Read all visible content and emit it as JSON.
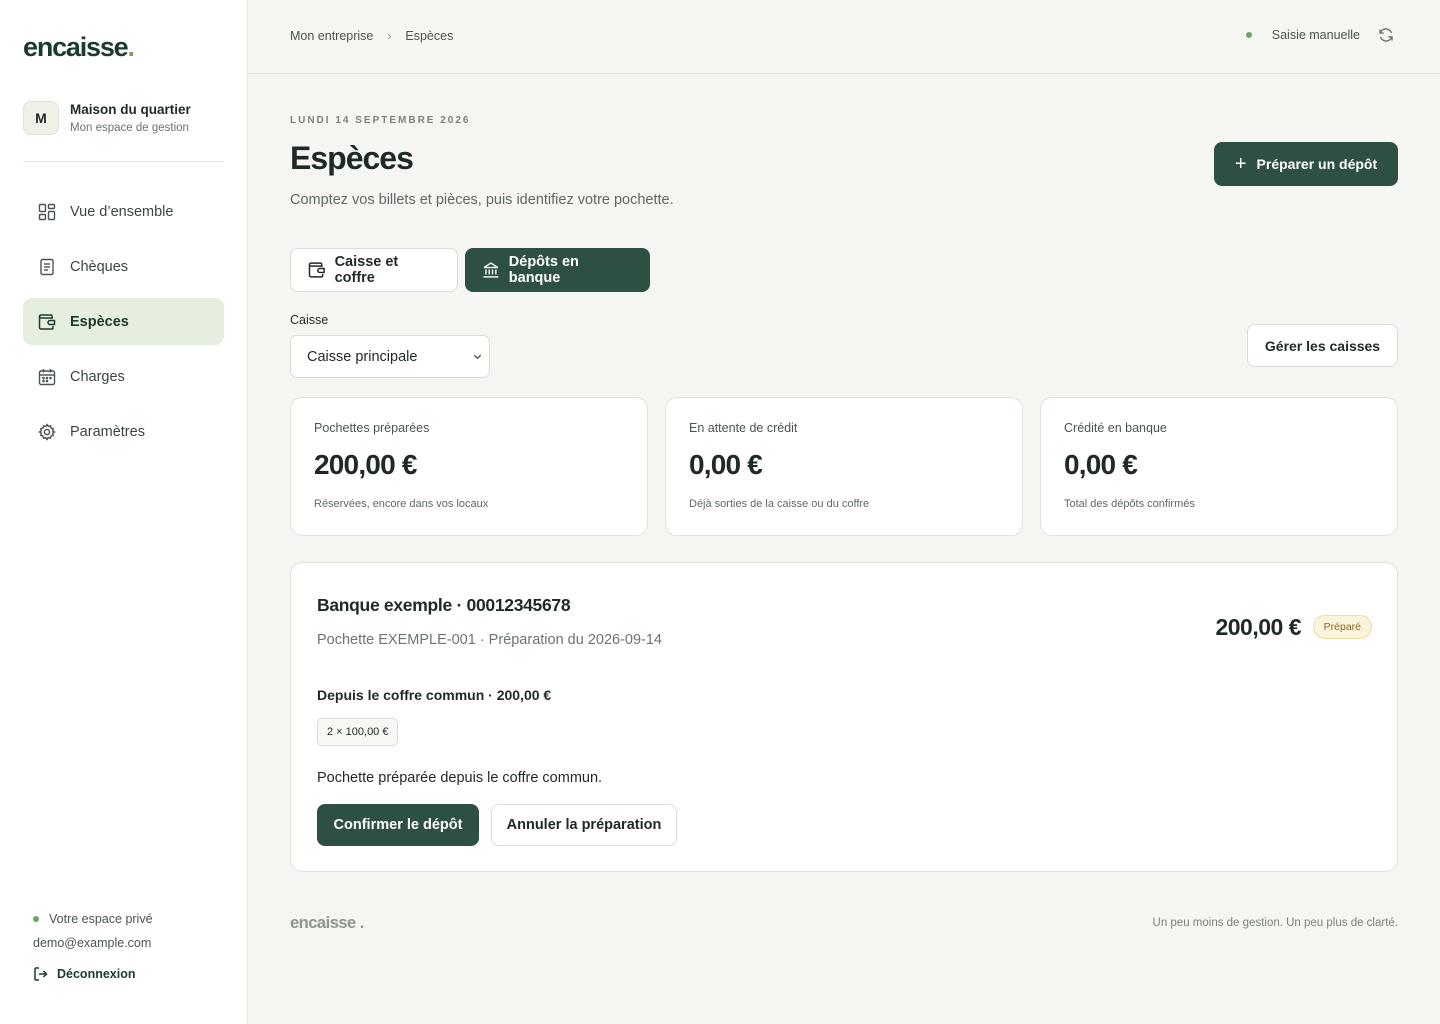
{
  "brand": {
    "logo": "encaisse",
    "logo_dot": ".",
    "accent": "#2e4f44",
    "dot_color": "#7ba05f"
  },
  "organization": {
    "initial": "M",
    "name": "Maison du quartier",
    "subtitle": "Mon espace de gestion"
  },
  "sidebar": {
    "items": [
      {
        "label": "Vue d’ensemble",
        "icon": "grid-icon",
        "active": false
      },
      {
        "label": "Chèques",
        "icon": "document-icon",
        "active": false
      },
      {
        "label": "Espèces",
        "icon": "wallet-icon",
        "active": true
      },
      {
        "label": "Charges",
        "icon": "calendar-icon",
        "active": false
      },
      {
        "label": "Paramètres",
        "icon": "gear-icon",
        "active": false
      }
    ],
    "private_space": "Votre espace privé",
    "email": "demo@example.com",
    "logout": "Déconnexion"
  },
  "topbar": {
    "breadcrumb": [
      "Mon entreprise",
      "Espèces"
    ],
    "breadcrumb_sep": "›",
    "sync_status": "Saisie manuelle"
  },
  "page": {
    "date": "LUNDI 14 SEPTEMBRE 2026",
    "title": "Espèces",
    "subtitle": "Comptez vos billets et pièces, puis identifiez votre pochette.",
    "primary_action": "Préparer un dépôt",
    "plus": "+"
  },
  "tabs": [
    {
      "label": "Caisse et coffre",
      "icon": "wallet-icon",
      "active": false
    },
    {
      "label": "Dépôts en banque",
      "icon": "bank-icon",
      "active": true
    }
  ],
  "caisse": {
    "label": "Caisse",
    "selected": "Caisse principale",
    "manage_button": "Gérer les caisses"
  },
  "stats": [
    {
      "label": "Pochettes préparées",
      "value": "200,00 €",
      "note": "Réservées, encore dans vos locaux"
    },
    {
      "label": "En attente de crédit",
      "value": "0,00 €",
      "note": "Déjà sorties de la caisse ou du coffre"
    },
    {
      "label": "Crédité en banque",
      "value": "0,00 €",
      "note": "Total des dépôts confirmés"
    }
  ],
  "deposit": {
    "bank": "Banque exemple · 00012345678",
    "meta": "Pochette EXEMPLE-001 · Préparation du 2026-09-14",
    "amount": "200,00 €",
    "status": "Préparé",
    "source": "Depuis le coffre commun · 200,00 €",
    "denomination": "2 × 100,00 €",
    "description": "Pochette préparée depuis le coffre commun.",
    "confirm": "Confirmer le dépôt",
    "cancel": "Annuler la préparation"
  },
  "footer": {
    "logo": "encaisse .",
    "tagline": "Un peu moins de gestion. Un peu plus de clarté."
  }
}
